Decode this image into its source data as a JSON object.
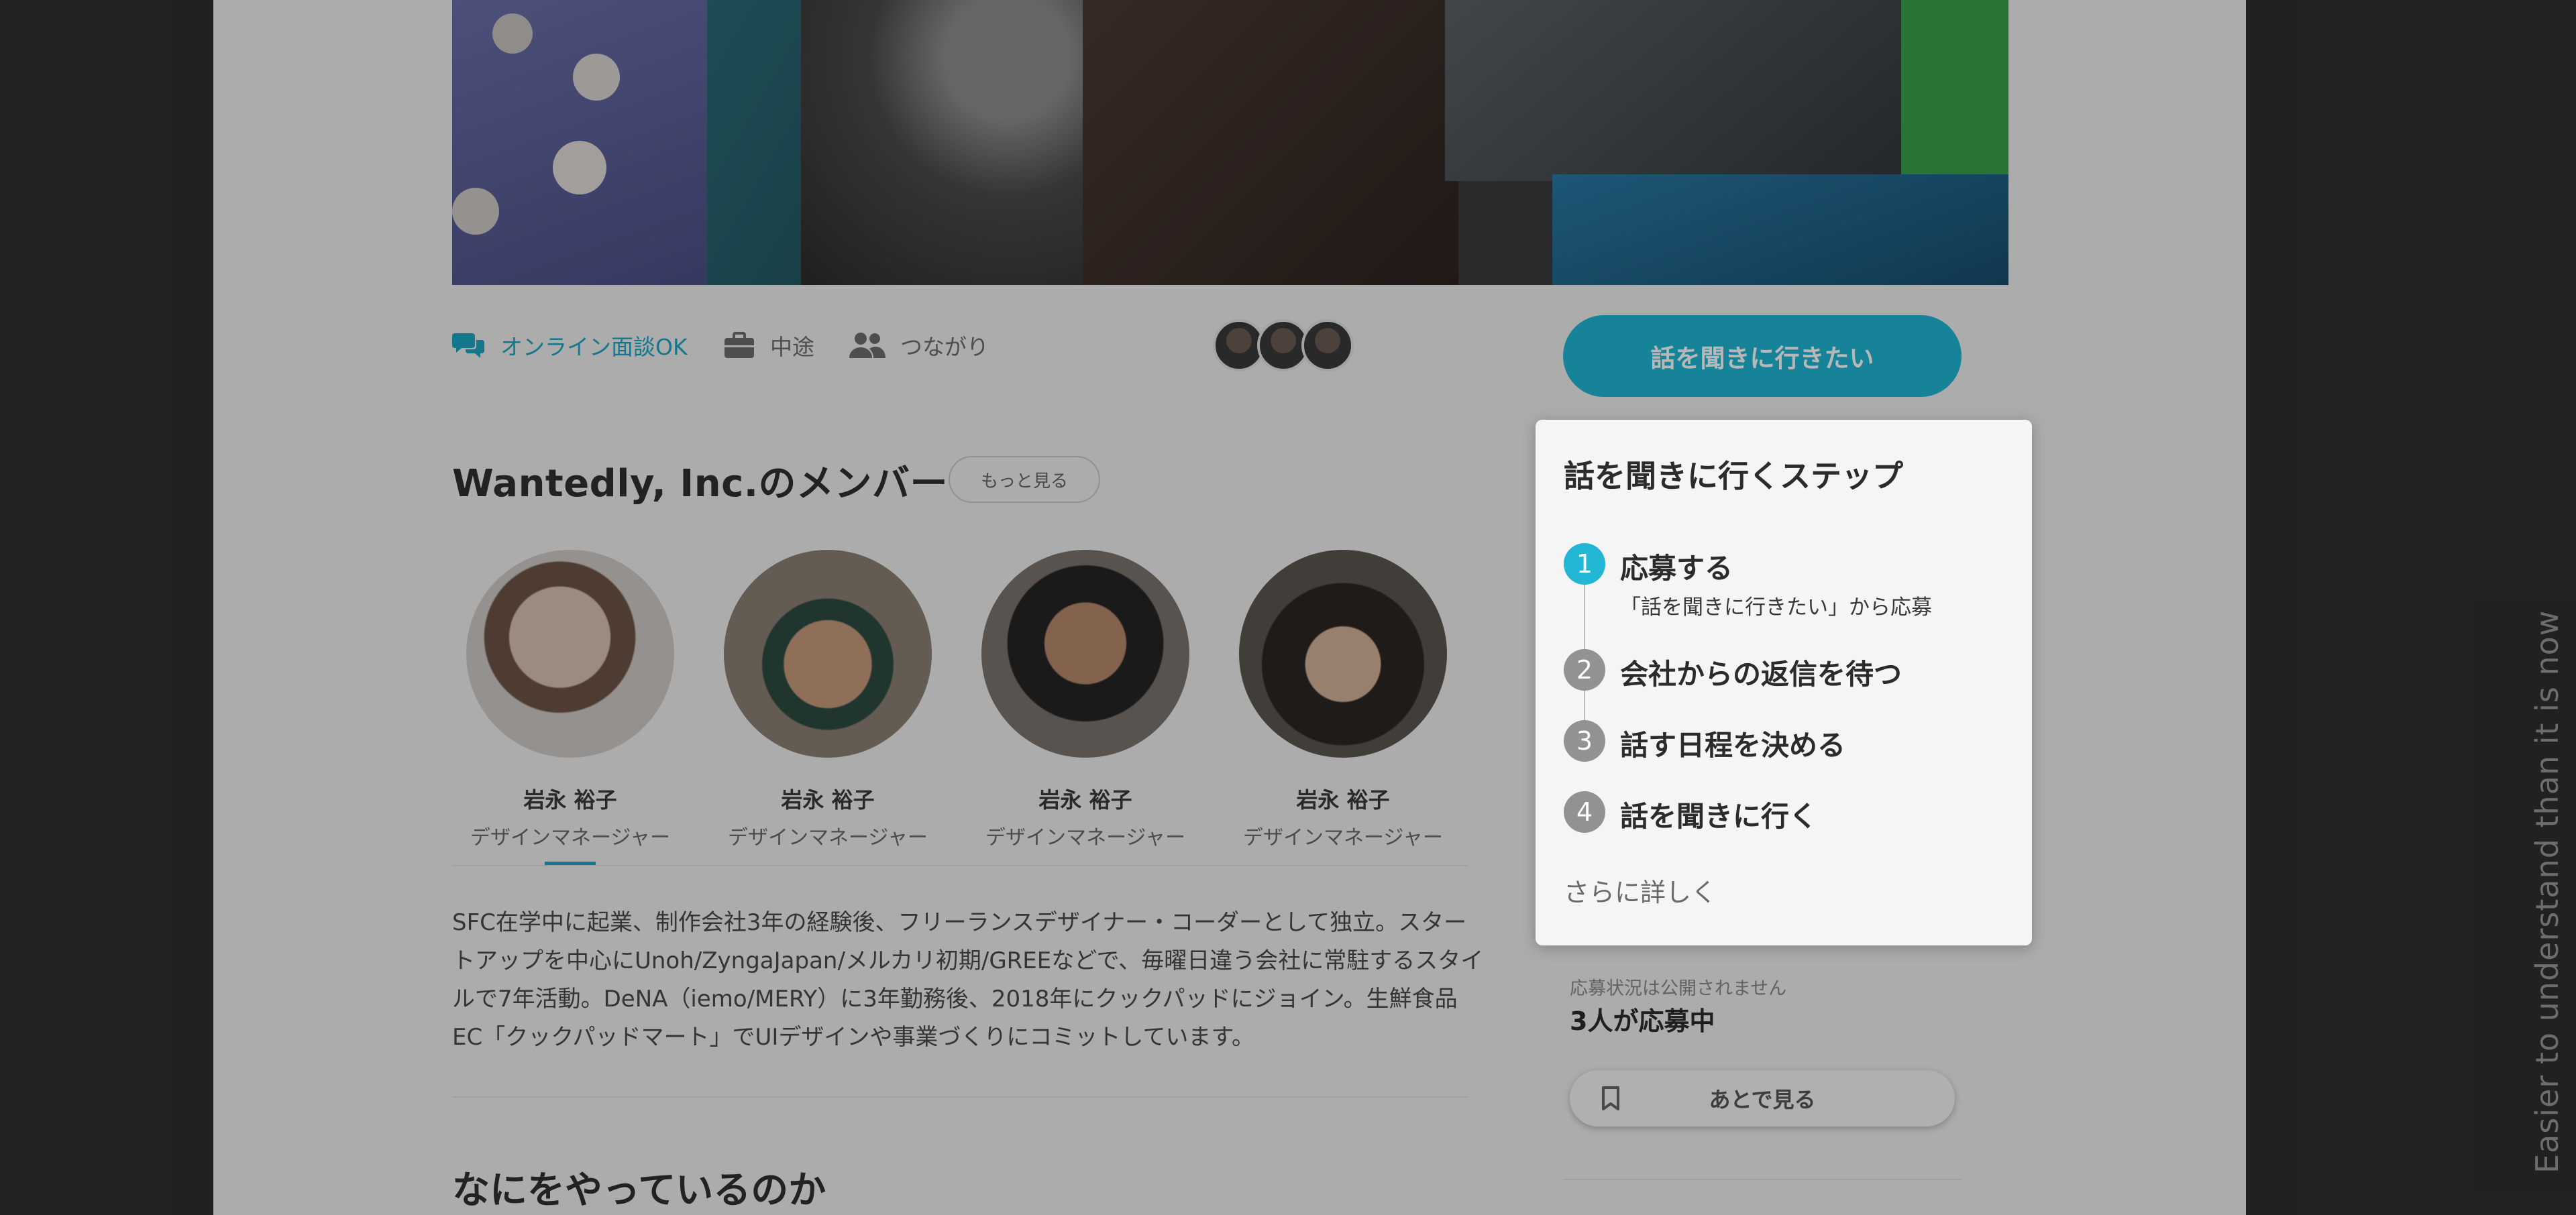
{
  "tags": {
    "online_interview": "オンライン面談OK",
    "employment_type": "中途",
    "connections": "つながり"
  },
  "members_section": {
    "title": "Wantedly, Inc.のメンバー",
    "more_button": "もっと見る",
    "members": [
      {
        "name": "岩永 裕子",
        "role": "デザインマネージャー"
      },
      {
        "name": "岩永 裕子",
        "role": "デザインマネージャー"
      },
      {
        "name": "岩永 裕子",
        "role": "デザインマネージャー"
      },
      {
        "name": "岩永 裕子",
        "role": "デザインマネージャー"
      }
    ],
    "bio": "SFC在学中に起業、制作会社3年の経験後、フリーランスデザイナー・コーダーとして独立。スタートアップを中心にUnoh/ZyngaJapan/メルカリ初期/GREEなどで、毎曜日違う会社に常駐するスタイルで7年活動。DeNA（iemo/MERY）に3年勤務後、2018年にクックパッドにジョイン。生鮮食品EC「クックパッドマート」でUIデザインや事業づくりにコミットしています。"
  },
  "next_section_title": "なにをやっているのか",
  "sidebar": {
    "apply_button": "話を聞きに行きたい",
    "status_note": "応募状況は公開されません",
    "applicants": "3人が応募中",
    "later_button": "あとで見る"
  },
  "popover": {
    "title": "話を聞きに行くステップ",
    "steps": [
      {
        "number": "1",
        "label": "応募する",
        "sub": "「話を聞きに行きたい」から応募"
      },
      {
        "number": "2",
        "label": "会社からの返信を待つ"
      },
      {
        "number": "3",
        "label": "話す日程を決める"
      },
      {
        "number": "4",
        "label": "話を聞きに行く"
      }
    ],
    "more_link": "さらに詳しく"
  },
  "tagline": "Easier to understand than it is now",
  "colors": {
    "accent": "#21b6d4",
    "step_inactive": "#929292",
    "backdrop": "#2f2f2f"
  }
}
